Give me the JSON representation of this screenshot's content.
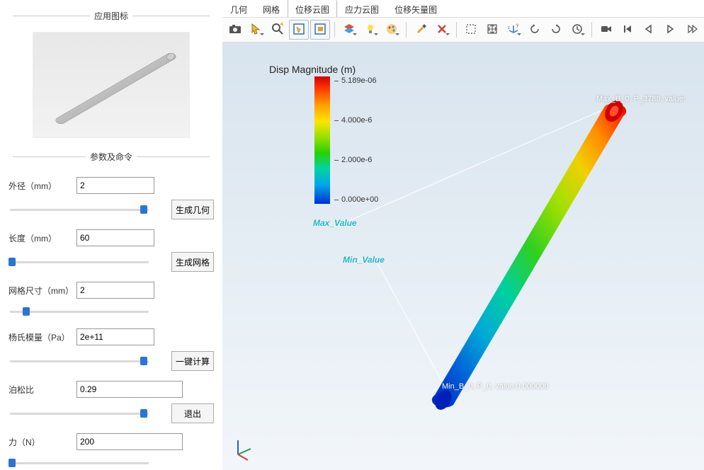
{
  "sidebar": {
    "icon_group_title": "应用图标",
    "params_group_title": "参数及命令",
    "params": {
      "outer_diameter": {
        "label": "外径（mm）",
        "value": "2"
      },
      "length": {
        "label": "长度（mm）",
        "value": "60"
      },
      "mesh_size": {
        "label": "网格尺寸（mm）",
        "value": "2"
      },
      "young": {
        "label": "杨氏模量（Pa）",
        "value": "2e+11"
      },
      "poisson": {
        "label": "泊松比",
        "value": "0.29"
      },
      "force": {
        "label": "力（N）",
        "value": "200"
      }
    },
    "buttons": {
      "gen_geometry": "生成几何",
      "gen_mesh": "生成网格",
      "compute": "一键计算",
      "exit": "退出"
    }
  },
  "tabs": {
    "geometry": "几何",
    "mesh": "网格",
    "disp_contour": "位移云图",
    "stress_contour": "应力云图",
    "disp_vector": "位移矢量图"
  },
  "viewport": {
    "legend_title": "Disp Magnitude (m)",
    "max_value_label": "Max_Value",
    "min_value_label": "Min_Value",
    "max_data_label": "Max_B_0, P_3788, value:",
    "min_data_label": "Min_B_0, P_0, value:0.000000"
  },
  "chart_data": {
    "type": "heatmap",
    "title": "Disp Magnitude (m)",
    "colormap": "rainbow",
    "range": [
      0.0,
      5.189e-06
    ],
    "ticks": [
      {
        "label": "5.189e-06",
        "value": 5.189e-06
      },
      {
        "label": "4.000e-6",
        "value": 4e-06
      },
      {
        "label": "2.000e-6",
        "value": 2e-06
      },
      {
        "label": "0.000e+00",
        "value": 0.0
      }
    ],
    "min_point": {
      "id": "P_0",
      "body": "B_0",
      "value": 0.0
    },
    "max_point": {
      "id": "P_3788",
      "body": "B_0",
      "value": 5.189e-06
    },
    "units": "m"
  }
}
